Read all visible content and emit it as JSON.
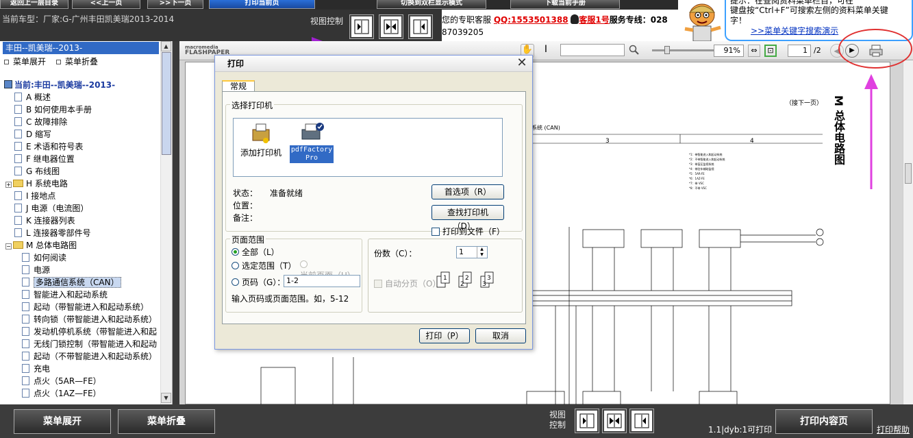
{
  "top_buttons": [
    "返回上一层目录",
    "<<上一页",
    ">>下一页",
    "打印当前页",
    "切换到双栏显示模式",
    "下载当前手册"
  ],
  "info": {
    "car_model": "当前车型：厂家:G-广州丰田凯美瑞2013-2014",
    "view_control": "视图控制"
  },
  "service": {
    "line1_prefix": "您的专职客服",
    "qq": "QQ:1553501388",
    "kefu": "客服1号",
    "hotline_label": "服务专线：028",
    "hotline_number": "87039205"
  },
  "tip": {
    "line1": "提示：在查阅资料菜单栏目，可在",
    "line2": "键盘按“Ctrl+F”可搜索左侧的资料菜单关键",
    "line3": "字！",
    "link": ">>菜单关键字搜索演示"
  },
  "sidebar": {
    "header": "丰田--凯美瑞--2013-",
    "expand": "菜单展开",
    "collapse": "菜单折叠",
    "current": "当前:丰田--凯美瑞--2013-",
    "items": [
      {
        "label": "A 概述",
        "level": 1,
        "type": "doc"
      },
      {
        "label": "B 如何使用本手册",
        "level": 1,
        "type": "doc"
      },
      {
        "label": "C 故障排除",
        "level": 1,
        "type": "doc"
      },
      {
        "label": "D 缩写",
        "level": 1,
        "type": "doc"
      },
      {
        "label": "E 术语和符号表",
        "level": 1,
        "type": "doc"
      },
      {
        "label": "F 继电器位置",
        "level": 1,
        "type": "doc"
      },
      {
        "label": "G 布线图",
        "level": 1,
        "type": "doc"
      },
      {
        "label": "H 系统电路",
        "level": 1,
        "type": "folder-closed"
      },
      {
        "label": "I 接地点",
        "level": 1,
        "type": "doc"
      },
      {
        "label": "J 电源（电流图）",
        "level": 1,
        "type": "doc"
      },
      {
        "label": "K 连接器列表",
        "level": 1,
        "type": "doc"
      },
      {
        "label": "L 连接器零部件号",
        "level": 1,
        "type": "doc"
      },
      {
        "label": "M 总体电路图",
        "level": 1,
        "type": "folder-open"
      },
      {
        "label": "如何阅读",
        "level": 2,
        "type": "doc"
      },
      {
        "label": "电源",
        "level": 2,
        "type": "doc"
      },
      {
        "label": "多路通信系统（CAN）",
        "level": 2,
        "type": "doc",
        "selected": true
      },
      {
        "label": "智能进入和起动系统",
        "level": 2,
        "type": "doc"
      },
      {
        "label": "起动（带智能进入和起动系统）",
        "level": 2,
        "type": "doc"
      },
      {
        "label": "转向锁（带智能进入和起动系统）",
        "level": 2,
        "type": "doc"
      },
      {
        "label": "发动机停机系统（带智能进入和起",
        "level": 2,
        "type": "doc"
      },
      {
        "label": "无线门锁控制（带智能进入和起动",
        "level": 2,
        "type": "doc"
      },
      {
        "label": "起动（不带智能进入和起动系统）",
        "level": 2,
        "type": "doc"
      },
      {
        "label": "充电",
        "level": 2,
        "type": "doc"
      },
      {
        "label": "点火（5AR—FE）",
        "level": 2,
        "type": "doc"
      },
      {
        "label": "点火（1AZ—FE）",
        "level": 2,
        "type": "doc"
      }
    ]
  },
  "viewer": {
    "logo_line1": "macromedia",
    "logo_line2": "FLASHPAPER",
    "zoom": "91%",
    "page": "1",
    "total": "/2"
  },
  "document": {
    "continue_label": "（接下一页）",
    "side_title": "M 总体电路图",
    "col3": "3",
    "col4": "4",
    "can_label": "系统 (CAN)"
  },
  "dialog": {
    "title": "打印",
    "tab": "常规",
    "select_printer": "选择打印机",
    "add_printer": "添加打印机",
    "pdf_printer_line1": "pdfFactory",
    "pdf_printer_line2": "Pro",
    "status_label": "状态：",
    "status_value": "准备就绪",
    "location_label": "位置：",
    "comment_label": "备注：",
    "preferences": "首选项（R）",
    "find_printer": "查找打印机（D）...",
    "print_to_file": "打印到文件（F）",
    "page_range": "页面范围",
    "all": "全部（L）",
    "selection": "选定范围（T）",
    "current_page": "当前页面（U）",
    "pages": "页码（G）：",
    "pages_value": "1-2",
    "pages_hint": "输入页码或页面范围。如，5-12",
    "copies": "份数（C）：",
    "copies_value": "1",
    "collate": "自动分页（O）",
    "print_button": "打印（P）",
    "cancel_button": "取消"
  },
  "bottom": {
    "expand": "菜单展开",
    "collapse": "菜单折叠",
    "view_control_1": "视图",
    "view_control_2": "控制",
    "status": "1.1|dyb:1可打印",
    "print_content": "打印内容页",
    "print_help": "打印帮助"
  },
  "colors": {
    "accent_blue": "#316ac5",
    "dark_bar": "#343434",
    "red_link": "#e00000",
    "annotation_red": "#e03030",
    "annotation_magenta": "#e040e0"
  }
}
